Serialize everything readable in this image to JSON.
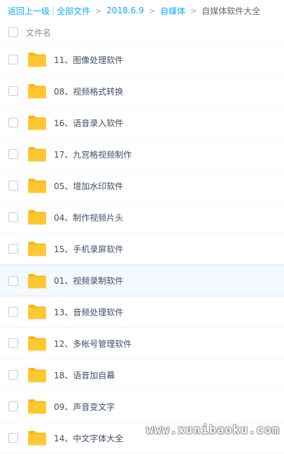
{
  "breadcrumb": {
    "back_label": "返回上一级",
    "separator_bar": "|",
    "all_files_label": "全部文件",
    "separator": ">",
    "path": [
      "2018.6.9",
      "自媒体"
    ],
    "current": "自媒体软件大全"
  },
  "list_header": {
    "column_label": "文件名"
  },
  "files": [
    {
      "name": "11、图像处理软件"
    },
    {
      "name": "08、视频格式转换"
    },
    {
      "name": "16、语音录入软件"
    },
    {
      "name": "17、九宫格视频制作"
    },
    {
      "name": "05、增加水印软件"
    },
    {
      "name": "04、制作视频片头"
    },
    {
      "name": "15、手机录屏软件"
    },
    {
      "name": "01、视频录制软件"
    },
    {
      "name": "13、音频处理软件"
    },
    {
      "name": "12、多帐号管理软件"
    },
    {
      "name": "18、语音加自幕"
    },
    {
      "name": "09、声音变文字"
    },
    {
      "name": "14、中文字体大全"
    }
  ],
  "highlighted_row": 7,
  "watermark": "www.xunibaoku.com",
  "colors": {
    "link": "#09aaff",
    "folder": "#ffc832",
    "folder_tab": "#f5b818",
    "text": "#424e67",
    "row_hover": "#f4f8ff"
  },
  "icons": {
    "folder": "folder-icon",
    "separator": "chevron-right-icon"
  }
}
